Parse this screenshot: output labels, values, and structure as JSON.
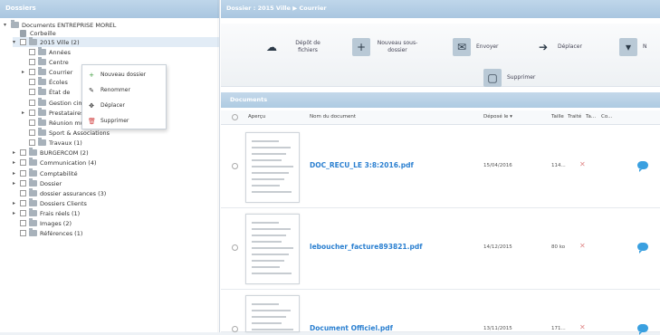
{
  "left_panel": {
    "title": "Dossiers",
    "tree": [
      {
        "label": "Documents ENTREPRISE MOREL",
        "level": 0,
        "toggle": "▾",
        "checkbox": false,
        "folder": true
      },
      {
        "label": "Corbeille",
        "level": 1,
        "toggle": "",
        "checkbox": false,
        "folder": false,
        "trash": true
      },
      {
        "label": "2015 Ville (2)",
        "level": 1,
        "toggle": "▾",
        "checkbox": true,
        "folder": true,
        "selected": true
      },
      {
        "label": "Années",
        "level": 2,
        "toggle": "",
        "checkbox": true,
        "folder": true
      },
      {
        "label": "Centre",
        "level": 2,
        "toggle": "",
        "checkbox": true,
        "folder": true
      },
      {
        "label": "Courrier",
        "level": 2,
        "toggle": "▸",
        "checkbox": true,
        "folder": true
      },
      {
        "label": "Écoles",
        "level": 2,
        "toggle": "",
        "checkbox": true,
        "folder": true
      },
      {
        "label": "État de",
        "level": 2,
        "toggle": "",
        "checkbox": true,
        "folder": true
      },
      {
        "label": "Gestion cimetière",
        "level": 2,
        "toggle": "",
        "checkbox": true,
        "folder": true
      },
      {
        "label": "Prestataires services",
        "level": 2,
        "toggle": "▸",
        "checkbox": true,
        "folder": true
      },
      {
        "label": "Réunion municipale",
        "level": 2,
        "toggle": "",
        "checkbox": true,
        "folder": true
      },
      {
        "label": "Sport & Associations",
        "level": 2,
        "toggle": "",
        "checkbox": true,
        "folder": true
      },
      {
        "label": "Travaux (1)",
        "level": 2,
        "toggle": "",
        "checkbox": true,
        "folder": true
      },
      {
        "label": "BURGERCOM (2)",
        "level": 1,
        "toggle": "▸",
        "checkbox": true,
        "folder": true
      },
      {
        "label": "Communication (4)",
        "level": 1,
        "toggle": "▸",
        "checkbox": true,
        "folder": true
      },
      {
        "label": "Comptabilité",
        "level": 1,
        "toggle": "▸",
        "checkbox": true,
        "folder": true
      },
      {
        "label": "Dossier",
        "level": 1,
        "toggle": "▸",
        "checkbox": true,
        "folder": true
      },
      {
        "label": "dossier assurances (3)",
        "level": 1,
        "toggle": "",
        "checkbox": true,
        "folder": true
      },
      {
        "label": "Dossiers Clients",
        "level": 1,
        "toggle": "▸",
        "checkbox": true,
        "folder": true
      },
      {
        "label": "Frais réels (1)",
        "level": 1,
        "toggle": "▸",
        "checkbox": true,
        "folder": true
      },
      {
        "label": "Images (2)",
        "level": 1,
        "toggle": "",
        "checkbox": true,
        "folder": true
      },
      {
        "label": "Références (1)",
        "level": 1,
        "toggle": "",
        "checkbox": true,
        "folder": true
      }
    ]
  },
  "context_menu": [
    {
      "icon": "+",
      "icon_name": "plus-icon",
      "label": "Nouveau dossier",
      "color": "#3a9a3a"
    },
    {
      "icon": "✎",
      "icon_name": "pencil-icon",
      "label": "Renommer",
      "color": "#333333"
    },
    {
      "icon": "✥",
      "icon_name": "move-icon",
      "label": "Déplacer",
      "color": "#333333"
    },
    {
      "icon": "🗑",
      "icon_name": "trash-icon",
      "label": "Supprimer",
      "color": "#d04040"
    }
  ],
  "breadcrumb": "Dossier : 2015 Ville ▶ Courrier",
  "toolbar": [
    {
      "name": "depot-fichiers",
      "icon": "☁",
      "icon_name": "cloud-upload-icon",
      "label": "Dépôt de fichiers"
    },
    {
      "name": "nouveau-sous-dossier",
      "icon": "+",
      "icon_name": "new-folder-icon",
      "label": "Nouveau sous-dossier"
    },
    {
      "name": "envoyer",
      "icon": "✉",
      "icon_name": "mail-icon",
      "label": "Envoyer"
    },
    {
      "name": "deplacer",
      "icon": "➔",
      "icon_name": "arrow-right-icon",
      "label": "Déplacer"
    },
    {
      "name": "partager",
      "icon": "▾",
      "icon_name": "folder-share-icon",
      "label": "N"
    },
    {
      "name": "supprimer",
      "icon": "▢",
      "icon_name": "trash-folder-icon",
      "label": "Supprimer"
    }
  ],
  "documents": {
    "title": "Documents",
    "columns": [
      "Aperçu",
      "Nom du document",
      "Déposé le ▾",
      "Taille",
      "Traité",
      "Ta...",
      "Co..."
    ],
    "rows": [
      {
        "name": "DOC_RECU_LE 3:8:2016.pdf",
        "date": "15/04/2016",
        "size": "114..."
      },
      {
        "name": "leboucher_facture893821.pdf",
        "date": "14/12/2015",
        "size": "80 ko"
      },
      {
        "name": "Document Officiel.pdf",
        "date": "13/11/2015",
        "size": "171..."
      }
    ]
  }
}
